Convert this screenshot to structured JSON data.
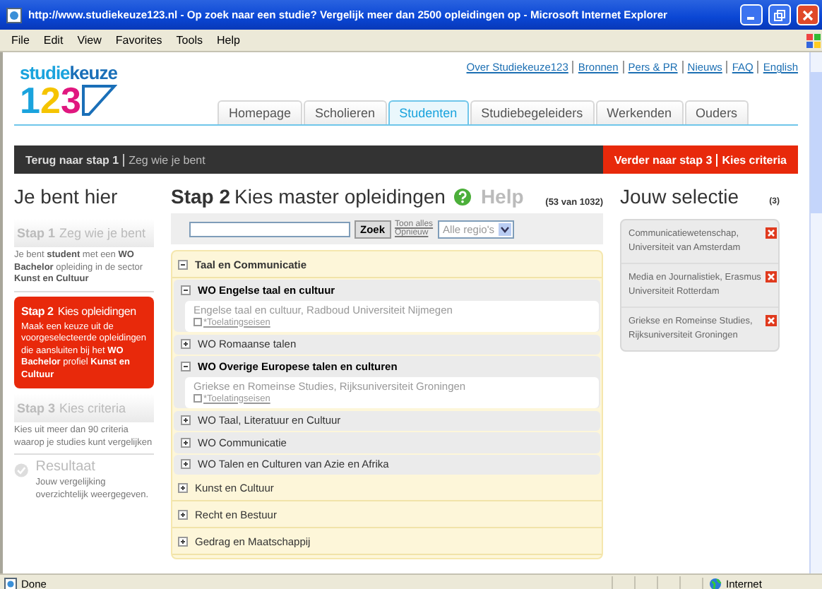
{
  "window": {
    "title": "http://www.studiekeuze123.nl - Op zoek naar een studie? Vergelijk meer dan 2500 opleidingen op  - Microsoft Internet Explorer"
  },
  "menu": [
    "File",
    "Edit",
    "View",
    "Favorites",
    "Tools",
    "Help"
  ],
  "site": {
    "logo_word": [
      "studie",
      "keuze"
    ],
    "logo_digits": [
      {
        "text": "1",
        "color": "#1aa3dd"
      },
      {
        "text": "2",
        "color": "#f5c400"
      },
      {
        "text": "3",
        "color": "#e0177f"
      }
    ],
    "top_links": [
      "Over Studiekeuze123",
      "Bronnen",
      "Pers & PR",
      "Nieuws",
      "FAQ",
      "English"
    ],
    "tabs": [
      {
        "label": "Homepage",
        "selected": false
      },
      {
        "label": "Scholieren",
        "selected": false
      },
      {
        "label": "Studenten",
        "selected": true
      },
      {
        "label": "Studiebegeleiders",
        "selected": false
      },
      {
        "label": "Werkenden",
        "selected": false
      },
      {
        "label": "Ouders",
        "selected": false
      }
    ]
  },
  "step_bar": {
    "back_label": "Terug naar stap 1",
    "back_detail": "Zeg wie je bent",
    "next_label": "Verder naar stap 3",
    "next_detail": "Kies criteria"
  },
  "sidebar": {
    "title": "Je bent hier",
    "steps": [
      {
        "kind": "step",
        "number": "Stap 1",
        "label": "Zeg wie je bent",
        "active": false,
        "description": "Je bent **student** met een **WO Bachelor** opleiding in de sector **Kunst en Cultuur**"
      },
      {
        "kind": "step",
        "number": "Stap 2",
        "label": "Kies opleidingen",
        "active": true,
        "description": "Maak een keuze uit de voorgeselecteerde opleidingen die aansluiten bij het **WO Bachelor** profiel **Kunst en Cultuur**"
      },
      {
        "kind": "step",
        "number": "Stap 3",
        "label": "Kies criteria",
        "active": false,
        "description": "Kies uit meer dan 90 criteria waarop je studies kunt vergelijken"
      },
      {
        "kind": "result",
        "label": "Resultaat",
        "description": "Jouw vergelijking overzichtelijk weergegeven."
      }
    ]
  },
  "main": {
    "step_number": "Stap 2",
    "title": "Kies master opleidingen",
    "help": "Help",
    "count": "(53 van 1032)",
    "search": {
      "button": "Zoek",
      "links": [
        "Toon alles",
        "Opnieuw"
      ],
      "region": "Alle regio's"
    },
    "tree": [
      {
        "kind": "category",
        "label": "Taal en Communicatie",
        "expanded": true,
        "children": [
          {
            "kind": "group",
            "label": "WO Engelse taal en cultuur",
            "expanded": true,
            "children": [
              {
                "kind": "result",
                "label": "Engelse taal en cultuur, Radboud Universiteit Nijmegen",
                "link": "*Toelatingseisen"
              }
            ]
          },
          {
            "kind": "group",
            "label": "WO Romaanse talen",
            "expanded": false
          },
          {
            "kind": "group",
            "label": "WO Overige Europese talen en culturen",
            "expanded": true,
            "children": [
              {
                "kind": "result",
                "label": "Griekse en Romeinse Studies, Rijksuniversiteit Groningen",
                "link": "*Toelatingseisen"
              }
            ]
          },
          {
            "kind": "group",
            "label": "WO Taal, Literatuur en Cultuur",
            "expanded": false
          },
          {
            "kind": "group",
            "label": "WO Communicatie",
            "expanded": false
          },
          {
            "kind": "group",
            "label": "WO Talen en Culturen van Azie en Afrika",
            "expanded": false
          }
        ]
      },
      {
        "kind": "category",
        "label": "Kunst en Cultuur",
        "expanded": false
      },
      {
        "kind": "category",
        "label": "Recht en Bestuur",
        "expanded": false
      },
      {
        "kind": "category",
        "label": "Gedrag en Maatschappij",
        "expanded": false
      }
    ]
  },
  "selection": {
    "title": "Jouw selectie",
    "count": "(3)",
    "items": [
      "Communicatiewetenschap, Universiteit van Amsterdam",
      "Media en Journalistiek, Erasmus Universiteit Rotterdam",
      "Griekse en Romeinse Studies, Rijksuniversiteit Groningen"
    ]
  },
  "status_bar": {
    "text": "Done",
    "zone": "Internet"
  }
}
